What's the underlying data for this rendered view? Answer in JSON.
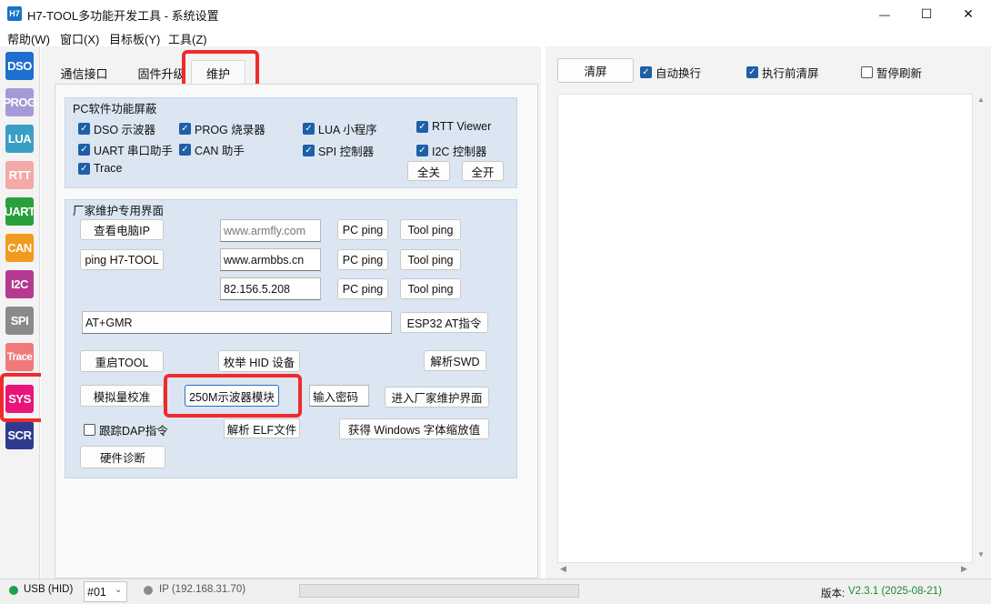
{
  "window": {
    "title": "H7-TOOL多功能开发工具 - 系统设置",
    "logo_text": "H7",
    "minimize_glyph": "—",
    "maximize_glyph": "☐",
    "close_glyph": "✕"
  },
  "menu": [
    "帮助(W)",
    "窗口(X)",
    "目标板(Y)",
    "工具(Z)"
  ],
  "toolbar": [
    {
      "label": "DSO",
      "color": "#1e6fd0"
    },
    {
      "label": "PROG",
      "color": "#a59ad6"
    },
    {
      "label": "LUA",
      "color": "#3a9fc4"
    },
    {
      "label": "RTT",
      "color": "#f5a8a8"
    },
    {
      "label": "UART",
      "color": "#2aa03c"
    },
    {
      "label": "CAN",
      "color": "#f29a1e"
    },
    {
      "label": "I2C",
      "color": "#b5398f"
    },
    {
      "label": "SPI",
      "color": "#8a8a8a"
    },
    {
      "label": "Trace",
      "color": "#f07a7a"
    },
    {
      "label": "SYS",
      "color": "#e8147a"
    },
    {
      "label": "SCR",
      "color": "#2f3a8f"
    }
  ],
  "tabs": [
    "通信接口",
    "固件升级",
    "维护"
  ],
  "pc_group": {
    "title": "PC软件功能屏蔽",
    "checks": [
      "DSO 示波器",
      "PROG 烧录器",
      "LUA 小程序",
      "RTT Viewer",
      "UART 串口助手",
      "CAN 助手",
      "SPI 控制器",
      "I2C 控制器",
      "Trace"
    ],
    "btn_all_off": "全关",
    "btn_all_on": "全开"
  },
  "factory_group": {
    "title": "厂家维护专用界面",
    "btn_view_ip": "查看电脑IP",
    "btn_ping_tool": "ping H7-TOOL",
    "hosts": [
      "www.armfly.com",
      "www.armbbs.cn",
      "82.156.5.208"
    ],
    "btn_pc_ping": "PC ping",
    "btn_tool_ping": "Tool ping",
    "at_value": "AT+GMR",
    "btn_esp32": "ESP32 AT指令",
    "btn_restart": "重启TOOL",
    "btn_enum_hid": "枚举 HID 设备",
    "btn_parse_swd": "解析SWD",
    "btn_calib": "模拟量校准",
    "btn_250m": "250M示波器模块",
    "password_placeholder": "输入密码",
    "btn_enter_factory": "进入厂家维护界面",
    "chk_trace_dap": "跟踪DAP指令",
    "btn_parse_elf": "解析 ELF文件",
    "btn_win_font": "获得 Windows 字体缩放值",
    "btn_hw_diag": "硬件诊断"
  },
  "right": {
    "btn_clear": "清屏",
    "chk_auto_wrap": "自动换行",
    "chk_clear_before": "执行前清屏",
    "chk_pause": "暂停刷新"
  },
  "status": {
    "usb": "USB (HID)",
    "device": "#01",
    "ip": "IP (192.168.31.70)",
    "version_label": "版本:",
    "version": "V2.3.1 (2025-08-21)",
    "usb_color": "#1aa34a",
    "ip_color": "#8a8a8a",
    "version_color": "#1a8a2e"
  }
}
